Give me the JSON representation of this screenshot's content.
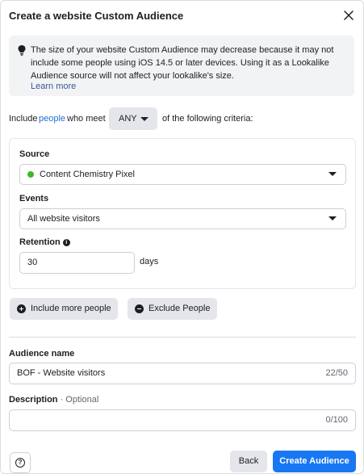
{
  "dialog": {
    "title": "Create a website Custom Audience",
    "close_icon": "close-icon"
  },
  "notice": {
    "icon": "lightbulb-icon",
    "text": "The size of your website Custom Audience may decrease because it may not include some people using iOS 14.5 or later devices. Using it as a Lookalike Audience source will not affect your lookalike's size.",
    "link": "Learn more"
  },
  "criteria": {
    "prefix": "Include",
    "people_link": "people",
    "middle": "who meet",
    "match_value": "ANY",
    "suffix": "of the following criteria:"
  },
  "source": {
    "label": "Source",
    "value": "Content Chemistry Pixel",
    "status_color": "#42b72a"
  },
  "events": {
    "label": "Events",
    "value": "All website visitors"
  },
  "retention": {
    "label": "Retention",
    "info_icon": "info-icon",
    "value": "30",
    "unit": "days"
  },
  "actions": {
    "include_more": "Include more people",
    "exclude": "Exclude People"
  },
  "audience_name": {
    "label": "Audience name",
    "value": "BOF - Website visitors",
    "counter": "22/50"
  },
  "description": {
    "label": "Description",
    "optional": "· Optional",
    "value": "",
    "counter": "0/100"
  },
  "footer": {
    "help_icon": "help-icon",
    "back": "Back",
    "create": "Create Audience"
  },
  "colors": {
    "primary": "#1877f2",
    "link": "#216fdb",
    "muted_bg": "#e4e6eb"
  }
}
